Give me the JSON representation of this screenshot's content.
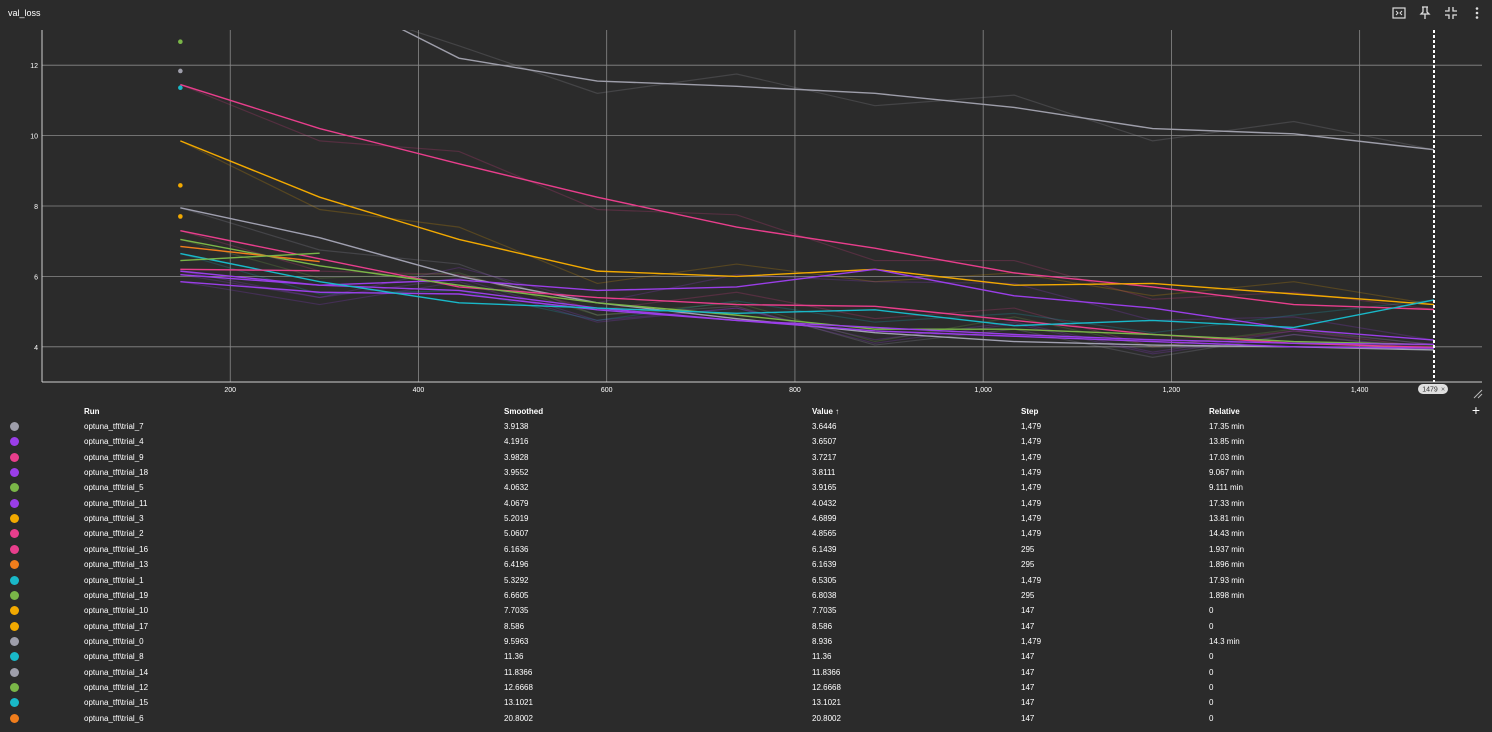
{
  "card": {
    "title": "val_loss"
  },
  "toolbar": {
    "icons": [
      "fit-to-data-icon",
      "pin-icon",
      "collapse-icon",
      "more-vert-icon"
    ]
  },
  "chart_data": {
    "type": "line",
    "title": "val_loss",
    "xlabel": "",
    "ylabel": "",
    "xlim": [
      0,
      1530
    ],
    "ylim": [
      3,
      13
    ],
    "x_ticks": [
      200,
      400,
      600,
      800,
      1000,
      1200,
      1400
    ],
    "x_tick_labels": [
      "200",
      "400",
      "600",
      "800",
      "1,000",
      "1,200",
      "1,400"
    ],
    "y_ticks": [
      4,
      6,
      8,
      10,
      12
    ],
    "y_tick_labels": [
      "4",
      "6",
      "8",
      "10",
      "12"
    ],
    "grid": true,
    "cursor_step": 1479,
    "cursor_label": "1479",
    "series": [
      {
        "name": "optuna_tft\\trial_0",
        "color": "#9e9eaa",
        "x": [
          147,
          295,
          443,
          590,
          738,
          885,
          1033,
          1180,
          1330,
          1479
        ],
        "y": [
          14.6,
          14.2,
          12.2,
          11.55,
          11.4,
          11.2,
          10.8,
          10.2,
          10.05,
          9.6
        ]
      },
      {
        "name": "optuna_tft\\trial_2",
        "color": "#e83e8c",
        "x": [
          147,
          295,
          443,
          590,
          738,
          885,
          1033,
          1180,
          1330,
          1479
        ],
        "y": [
          11.45,
          10.2,
          9.2,
          8.25,
          7.4,
          6.8,
          6.1,
          5.7,
          5.2,
          5.06
        ]
      },
      {
        "name": "optuna_tft\\trial_3",
        "color": "#f2a900",
        "x": [
          147,
          295,
          443,
          590,
          738,
          885,
          1033,
          1180,
          1330,
          1479
        ],
        "y": [
          9.85,
          8.25,
          7.05,
          6.15,
          6.0,
          6.2,
          5.75,
          5.8,
          5.5,
          5.2
        ]
      },
      {
        "name": "optuna_tft\\trial_7",
        "color": "#a0a0b0",
        "x": [
          147,
          295,
          443,
          590,
          738,
          885,
          1033,
          1180,
          1330,
          1479
        ],
        "y": [
          7.95,
          7.1,
          6.0,
          5.25,
          4.8,
          4.4,
          4.15,
          4.05,
          4.0,
          3.91
        ]
      },
      {
        "name": "optuna_tft\\trial_4",
        "color": "#9a3ee8",
        "x": [
          147,
          295,
          443,
          590,
          738,
          885,
          1033,
          1180,
          1330,
          1479
        ],
        "y": [
          6.15,
          5.75,
          5.9,
          5.6,
          5.7,
          6.2,
          5.45,
          5.1,
          4.5,
          4.19
        ]
      },
      {
        "name": "optuna_tft\\trial_9",
        "color": "#e83e8c",
        "x": [
          147,
          295,
          443,
          590,
          738,
          885,
          1033,
          1180,
          1330,
          1479
        ],
        "y": [
          7.3,
          6.5,
          5.7,
          5.4,
          5.2,
          5.15,
          4.75,
          4.35,
          4.1,
          3.98
        ]
      },
      {
        "name": "optuna_tft\\trial_18",
        "color": "#9a3ee8",
        "x": [
          147,
          295,
          443,
          590,
          738,
          885,
          1033,
          1180,
          1330,
          1479
        ],
        "y": [
          5.85,
          5.55,
          5.5,
          5.05,
          4.75,
          4.45,
          4.3,
          4.15,
          4.0,
          3.96
        ]
      },
      {
        "name": "optuna_tft\\trial_5",
        "color": "#7ab648",
        "x": [
          147,
          295,
          443,
          590,
          738,
          885,
          1033,
          1180,
          1330,
          1479
        ],
        "y": [
          7.05,
          6.3,
          5.75,
          5.25,
          4.9,
          4.5,
          4.5,
          4.35,
          4.15,
          4.06
        ]
      },
      {
        "name": "optuna_tft\\trial_11",
        "color": "#9a3ee8",
        "x": [
          147,
          295,
          443,
          590,
          738,
          885,
          1033,
          1180,
          1330,
          1479
        ],
        "y": [
          6.05,
          5.75,
          5.6,
          5.1,
          4.75,
          4.55,
          4.35,
          4.2,
          4.1,
          4.07
        ]
      },
      {
        "name": "optuna_tft\\trial_1",
        "color": "#19b8c8",
        "x": [
          147,
          295,
          443,
          590,
          738,
          885,
          1033,
          1180,
          1330,
          1479
        ],
        "y": [
          6.65,
          5.85,
          5.25,
          5.1,
          4.95,
          5.05,
          4.6,
          4.75,
          4.55,
          5.33
        ]
      },
      {
        "name": "optuna_tft\\trial_16",
        "color": "#e83e8c",
        "x": [
          147,
          295
        ],
        "y": [
          6.2,
          6.16
        ]
      },
      {
        "name": "optuna_tft\\trial_13",
        "color": "#f07d1c",
        "x": [
          147,
          295
        ],
        "y": [
          6.85,
          6.42
        ]
      },
      {
        "name": "optuna_tft\\trial_19",
        "color": "#7ab648",
        "x": [
          147,
          295
        ],
        "y": [
          6.45,
          6.66
        ]
      }
    ],
    "point_runs": [
      {
        "name": "optuna_tft\\trial_12",
        "color": "#7ab648",
        "x": 147,
        "y": 12.6668
      },
      {
        "name": "optuna_tft\\trial_14",
        "color": "#9e9eaa",
        "x": 147,
        "y": 11.8366
      },
      {
        "name": "optuna_tft\\trial_8",
        "color": "#19b8c8",
        "x": 147,
        "y": 11.36
      },
      {
        "name": "optuna_tft\\trial_17",
        "color": "#f2a900",
        "x": 147,
        "y": 8.586
      },
      {
        "name": "optuna_tft\\trial_10",
        "color": "#f2a900",
        "x": 147,
        "y": 7.7035
      }
    ]
  },
  "table": {
    "headers": {
      "run": "Run",
      "smoothed": "Smoothed",
      "value": "Value ↑",
      "step": "Step",
      "relative": "Relative"
    },
    "add_column_label": "+",
    "rows": [
      {
        "color": "#9e9eaa",
        "run": "optuna_tft\\trial_7",
        "smoothed": "3.9138",
        "value": "3.6446",
        "step": "1,479",
        "relative": "17.35 min"
      },
      {
        "color": "#9a3ee8",
        "run": "optuna_tft\\trial_4",
        "smoothed": "4.1916",
        "value": "3.6507",
        "step": "1,479",
        "relative": "13.85 min"
      },
      {
        "color": "#e83e8c",
        "run": "optuna_tft\\trial_9",
        "smoothed": "3.9828",
        "value": "3.7217",
        "step": "1,479",
        "relative": "17.03 min"
      },
      {
        "color": "#9a3ee8",
        "run": "optuna_tft\\trial_18",
        "smoothed": "3.9552",
        "value": "3.8111",
        "step": "1,479",
        "relative": "9.067 min"
      },
      {
        "color": "#7ab648",
        "run": "optuna_tft\\trial_5",
        "smoothed": "4.0632",
        "value": "3.9165",
        "step": "1,479",
        "relative": "9.111 min"
      },
      {
        "color": "#9a3ee8",
        "run": "optuna_tft\\trial_11",
        "smoothed": "4.0679",
        "value": "4.0432",
        "step": "1,479",
        "relative": "17.33 min"
      },
      {
        "color": "#f2a900",
        "run": "optuna_tft\\trial_3",
        "smoothed": "5.2019",
        "value": "4.6899",
        "step": "1,479",
        "relative": "13.81 min"
      },
      {
        "color": "#e83e8c",
        "run": "optuna_tft\\trial_2",
        "smoothed": "5.0607",
        "value": "4.8565",
        "step": "1,479",
        "relative": "14.43 min"
      },
      {
        "color": "#e83e8c",
        "run": "optuna_tft\\trial_16",
        "smoothed": "6.1636",
        "value": "6.1439",
        "step": "295",
        "relative": "1.937 min"
      },
      {
        "color": "#f07d1c",
        "run": "optuna_tft\\trial_13",
        "smoothed": "6.4196",
        "value": "6.1639",
        "step": "295",
        "relative": "1.896 min"
      },
      {
        "color": "#19b8c8",
        "run": "optuna_tft\\trial_1",
        "smoothed": "5.3292",
        "value": "6.5305",
        "step": "1,479",
        "relative": "17.93 min"
      },
      {
        "color": "#7ab648",
        "run": "optuna_tft\\trial_19",
        "smoothed": "6.6605",
        "value": "6.8038",
        "step": "295",
        "relative": "1.898 min"
      },
      {
        "color": "#f2a900",
        "run": "optuna_tft\\trial_10",
        "smoothed": "7.7035",
        "value": "7.7035",
        "step": "147",
        "relative": "0"
      },
      {
        "color": "#f2a900",
        "run": "optuna_tft\\trial_17",
        "smoothed": "8.586",
        "value": "8.586",
        "step": "147",
        "relative": "0"
      },
      {
        "color": "#9e9eaa",
        "run": "optuna_tft\\trial_0",
        "smoothed": "9.5963",
        "value": "8.936",
        "step": "1,479",
        "relative": "14.3 min"
      },
      {
        "color": "#19b8c8",
        "run": "optuna_tft\\trial_8",
        "smoothed": "11.36",
        "value": "11.36",
        "step": "147",
        "relative": "0"
      },
      {
        "color": "#9e9eaa",
        "run": "optuna_tft\\trial_14",
        "smoothed": "11.8366",
        "value": "11.8366",
        "step": "147",
        "relative": "0"
      },
      {
        "color": "#7ab648",
        "run": "optuna_tft\\trial_12",
        "smoothed": "12.6668",
        "value": "12.6668",
        "step": "147",
        "relative": "0"
      },
      {
        "color": "#19b8c8",
        "run": "optuna_tft\\trial_15",
        "smoothed": "13.1021",
        "value": "13.1021",
        "step": "147",
        "relative": "0"
      },
      {
        "color": "#f07d1c",
        "run": "optuna_tft\\trial_6",
        "smoothed": "20.8002",
        "value": "20.8002",
        "step": "147",
        "relative": "0"
      }
    ]
  }
}
